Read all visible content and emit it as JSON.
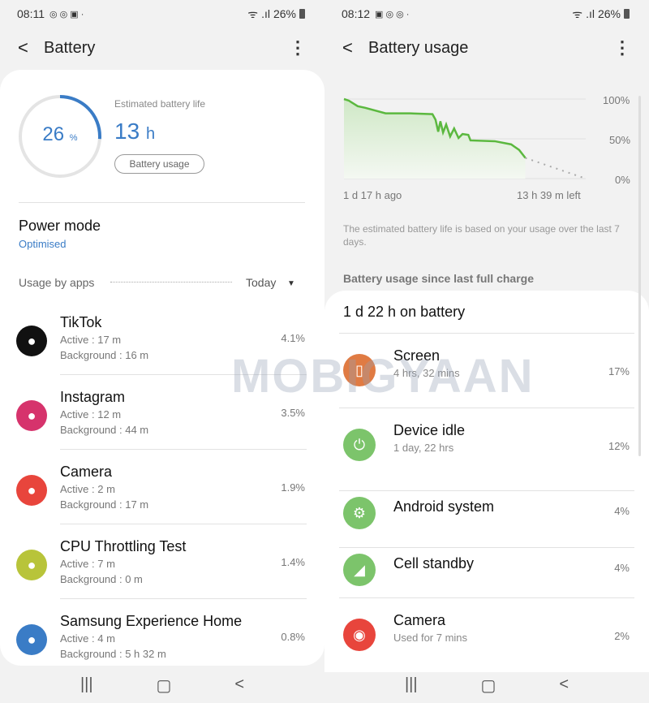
{
  "left": {
    "status": {
      "time": "08:11",
      "battery": "26%"
    },
    "header": {
      "title": "Battery"
    },
    "battery": {
      "percent": "26",
      "percent_unit": "%",
      "level": 0.26,
      "estimated_label": "Estimated battery life",
      "estimated_value": "13",
      "estimated_unit": "h",
      "usage_button": "Battery usage"
    },
    "power_mode": {
      "label": "Power mode",
      "value": "Optimised"
    },
    "usage": {
      "label": "Usage by apps",
      "period": "Today"
    },
    "apps": [
      {
        "name": "TikTok",
        "active": "Active : 17 m",
        "background": "Background : 16 m",
        "percent": "4.1%",
        "color": "#111111",
        "icon": "tiktok-icon"
      },
      {
        "name": "Instagram",
        "active": "Active : 12 m",
        "background": "Background : 44 m",
        "percent": "3.5%",
        "color": "#d6336c",
        "icon": "instagram-icon"
      },
      {
        "name": "Camera",
        "active": "Active : 2 m",
        "background": "Background : 17 m",
        "percent": "1.9%",
        "color": "#e8453c",
        "icon": "camera-icon"
      },
      {
        "name": "CPU Throttling Test",
        "active": "Active : 7 m",
        "background": "Background : 0 m",
        "percent": "1.4%",
        "color": "#b8c43a",
        "icon": "cpu-test-icon"
      },
      {
        "name": "Samsung Experience Home",
        "active": "Active : 4 m",
        "background": "Background : 5 h 32 m",
        "percent": "0.8%",
        "color": "#3a7cc6",
        "icon": "home-icon"
      }
    ]
  },
  "right": {
    "status": {
      "time": "08:12",
      "battery": "26%"
    },
    "header": {
      "title": "Battery usage"
    },
    "chart_data": {
      "type": "line",
      "xlabel_start": "1 d 17 h ago",
      "xlabel_end": "13 h 39 m left",
      "yticks": [
        "100%",
        "50%",
        "0%"
      ],
      "ylim": [
        0,
        100
      ],
      "series": [
        {
          "x": [
            -41,
            -39.9,
            -37.9,
            -36.2,
            -31.6,
            -26.1,
            -21.0,
            -20.3,
            -19.7,
            -19.2,
            -18.6,
            -17.9,
            -17.0,
            -16.1,
            -15.1,
            -14.2,
            -12.9,
            -12.4,
            -6.9,
            -3.2,
            -1.4,
            0
          ],
          "y": [
            100,
            98,
            91,
            89,
            82,
            82,
            81,
            74,
            59,
            72,
            58,
            68,
            53,
            63,
            51,
            56,
            55,
            48,
            47,
            43,
            36,
            26
          ],
          "color": "#5bb83f"
        },
        {
          "x": [
            0,
            13.65
          ],
          "y": [
            26,
            0
          ],
          "style": "dotted",
          "color": "#aaaaaa"
        }
      ]
    },
    "note": "The estimated battery life is based on your usage over the last 7 days.",
    "since_label": "Battery usage since last full charge",
    "on_battery": "1 d 22 h on battery",
    "items": [
      {
        "name": "Screen",
        "sub": "4 hrs, 32 mins",
        "percent": "17%",
        "color": "#e07b43",
        "icon": "screen-icon",
        "glyph": "▯"
      },
      {
        "name": "Device idle",
        "sub": "1 day, 22 hrs",
        "percent": "12%",
        "color": "#7cc46b",
        "icon": "power-icon",
        "glyph": "⏻"
      },
      {
        "name": "Android system",
        "sub": "",
        "percent": "4%",
        "color": "#7cc46b",
        "icon": "gear-icon",
        "glyph": "⚙"
      },
      {
        "name": "Cell standby",
        "sub": "",
        "percent": "4%",
        "color": "#7cc46b",
        "icon": "signal-icon",
        "glyph": "◢"
      },
      {
        "name": "Camera",
        "sub": "Used for 7 mins",
        "percent": "2%",
        "color": "#e8453c",
        "icon": "camera-icon",
        "glyph": "◉"
      }
    ]
  },
  "watermark": "MOBIGYAAN"
}
